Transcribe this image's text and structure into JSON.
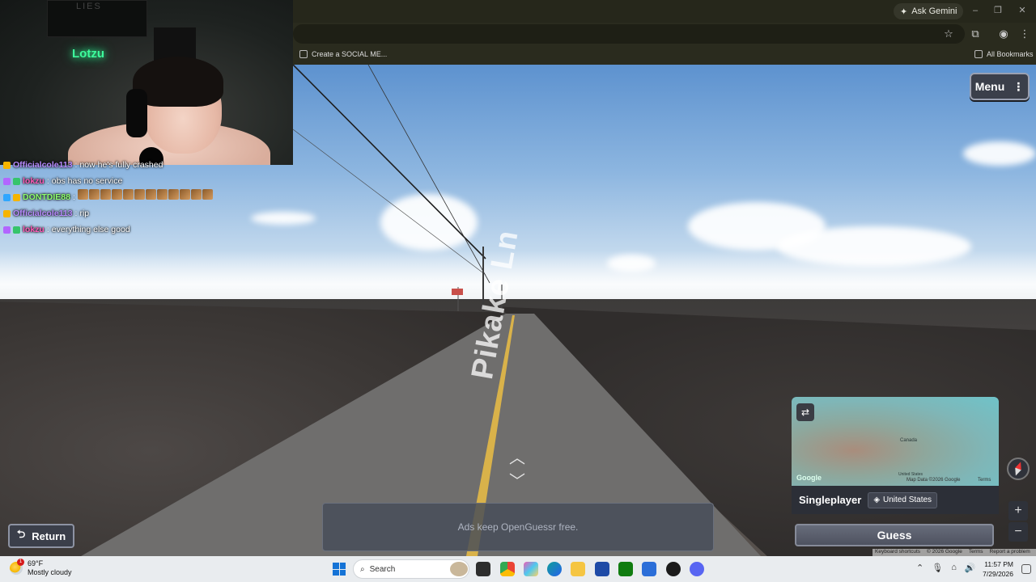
{
  "browser": {
    "gemini_label": "Ask Gemini",
    "bookmark_item": "Create a SOCIAL ME...",
    "all_bookmarks": "All Bookmarks"
  },
  "webcam": {
    "poster_text": "LIES",
    "neon_sign": "Lotzu"
  },
  "chat": {
    "messages": [
      {
        "user": "Officialcole113",
        "user_color": "#b88cff",
        "text": "now he's fully crashed"
      },
      {
        "user": "lokzu",
        "user_color": "#ff5ab8",
        "text": "obs has no service"
      },
      {
        "user": "DONTDIE88",
        "user_color": "#8eff6e",
        "text": ""
      },
      {
        "user": "Officialcole113",
        "user_color": "#b88cff",
        "text": "rip"
      },
      {
        "user": "lokzu",
        "user_color": "#ff5ab8",
        "text": "everything else good"
      }
    ]
  },
  "scene": {
    "road_label": "Pikake Ln"
  },
  "game": {
    "menu_label": "Menu",
    "map_country": "Canada",
    "map_us": "United States",
    "map_google": "Google",
    "map_attribution": "Map Data ©2026 Google",
    "map_terms": "Terms",
    "mode_label": "Singleplayer",
    "country_chip": "United States",
    "guess_label": "Guess",
    "return_label": "Return",
    "ad_text": "Ads keep OpenGuessr free.",
    "footer": {
      "shortcuts": "Keyboard shortcuts",
      "copyright": "© 2026 Google",
      "terms": "Terms",
      "report": "Report a problem"
    }
  },
  "taskbar": {
    "temperature": "69°F",
    "condition": "Mostly cloudy",
    "weather_badge": "1",
    "search_placeholder": "Search",
    "time": "11:57 PM",
    "date": "7/29/2026"
  },
  "colors": {
    "accent_green": "#3dfc9c",
    "game_panel": "#2c2f37"
  }
}
